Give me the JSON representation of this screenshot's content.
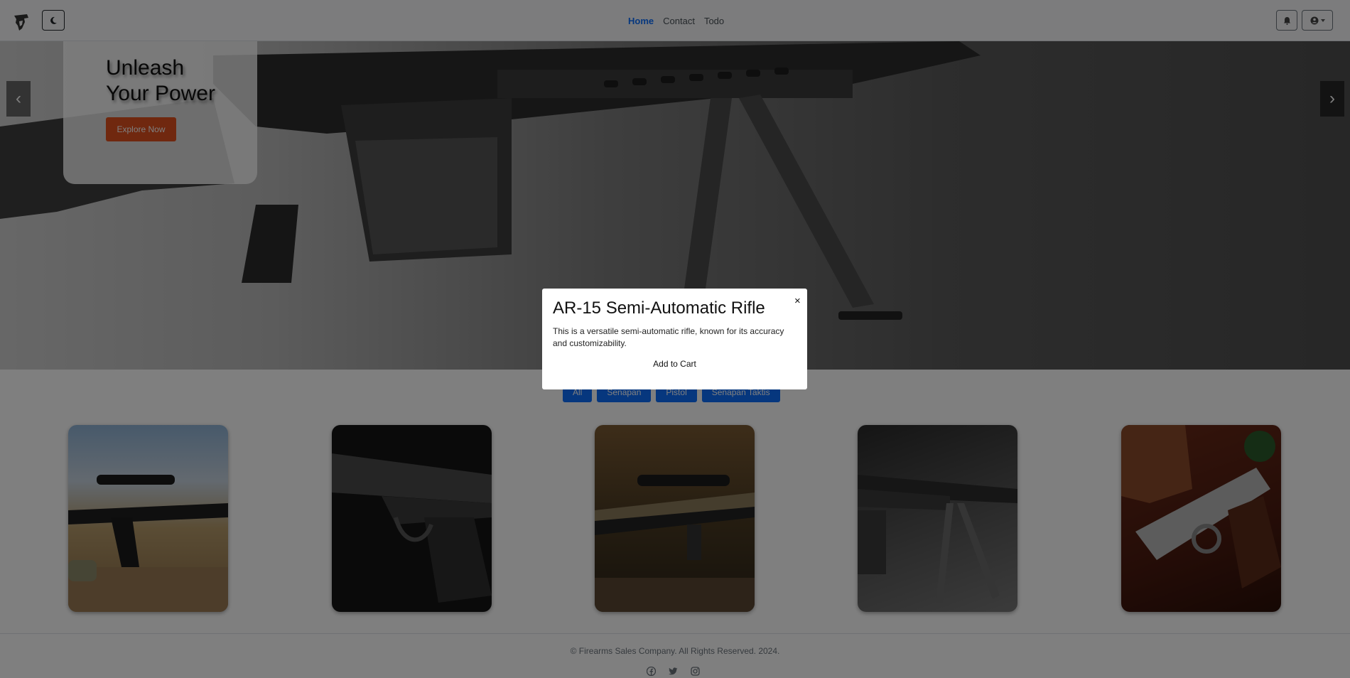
{
  "navbar": {
    "brand_icon": "soldier-logo-icon",
    "theme_icon": "moon-icon",
    "links": [
      "Home",
      "Contact",
      "Todo"
    ],
    "active_link": "Home",
    "notification_icon": "bell-icon",
    "user_icon": "user-circle-icon"
  },
  "hero": {
    "title_line1": "Unleash",
    "title_line2": "Your Power",
    "cta_label": "Explore Now",
    "prev_label": "‹",
    "next_label": "›"
  },
  "filters": [
    "All",
    "Senapan",
    "Pistol",
    "Senapan Taktis"
  ],
  "products": [
    {
      "image": "rifle-with-scope-outdoors"
    },
    {
      "image": "pistol-dark-background"
    },
    {
      "image": "sniper-rifle-forest"
    },
    {
      "image": "rifle-with-bipod"
    },
    {
      "image": "engraved-pistol-leather"
    }
  ],
  "footer": {
    "copyright": "© Firearms Sales Company. All Rights Reserved. 2024.",
    "social_icons": [
      "facebook-icon",
      "twitter-icon",
      "instagram-icon"
    ]
  },
  "modal": {
    "title": "AR-15 Semi-Automatic Rifle",
    "description": "This is a versatile semi-automatic rifle, known for its accuracy and customizability.",
    "close_label": "×",
    "action_label": "Add to Cart"
  },
  "colors": {
    "primary": "#0d6efd",
    "cta": "#e0501f",
    "overlay": "rgba(0,0,0,0.5)"
  }
}
